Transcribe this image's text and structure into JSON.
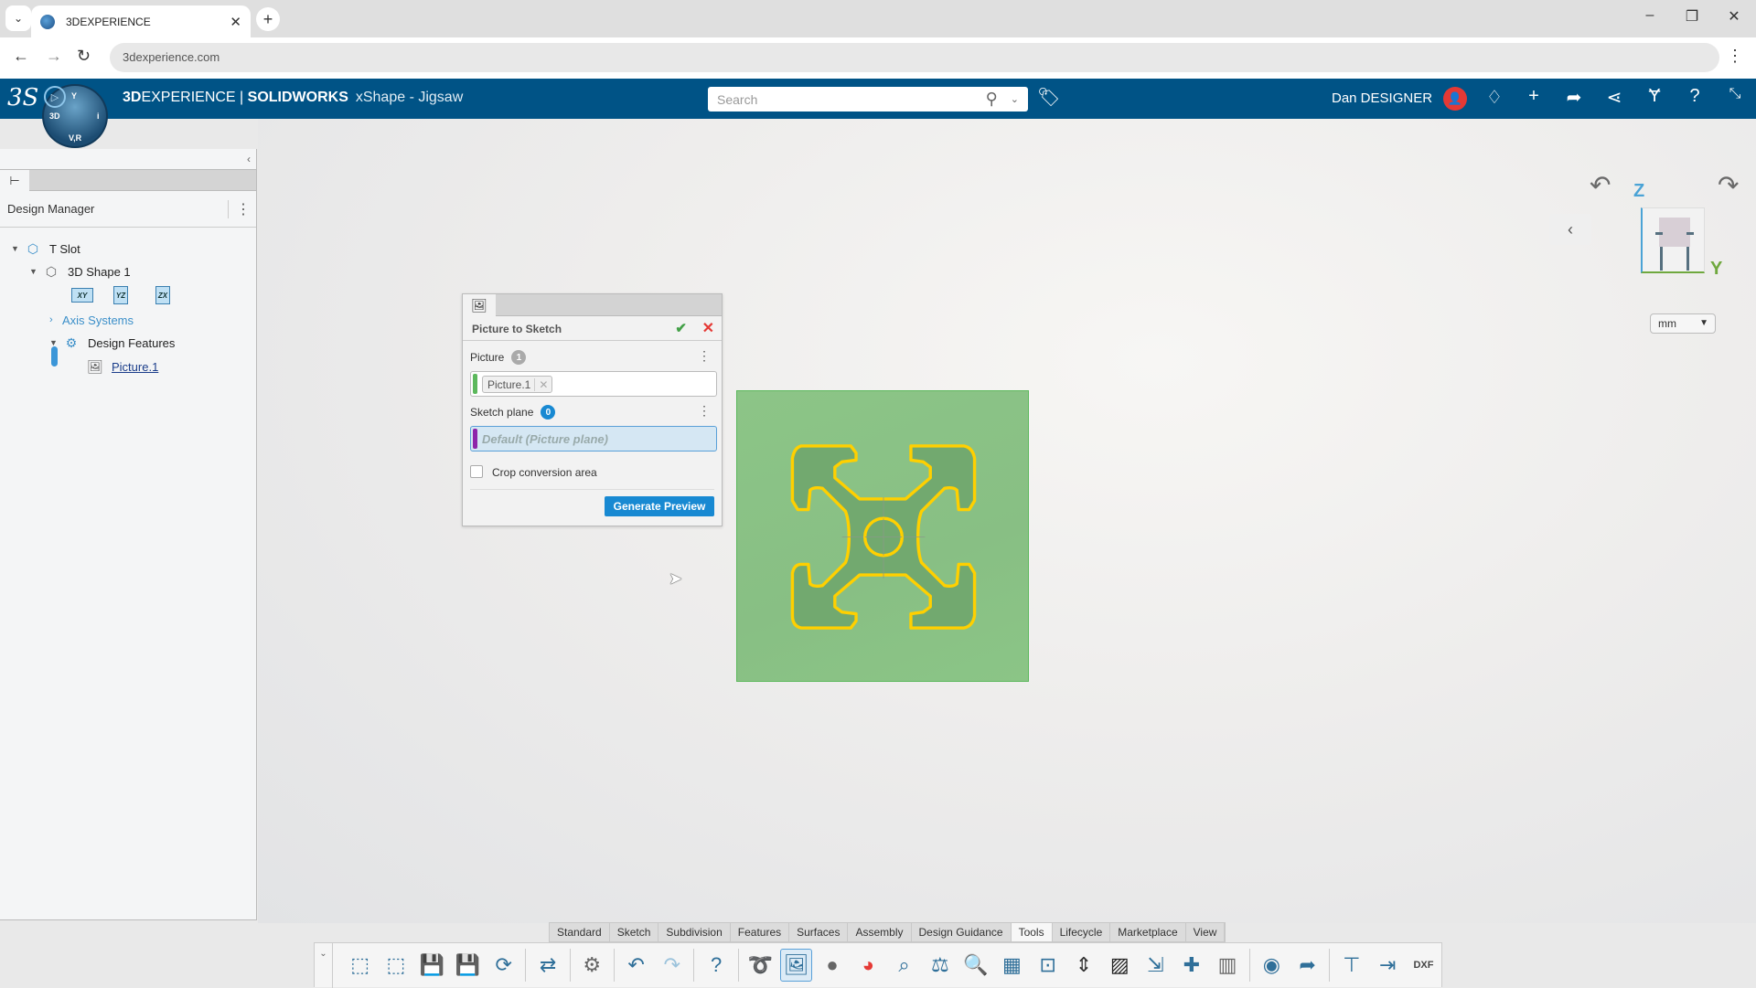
{
  "browser": {
    "tab_title": "3DEXPERIENCE",
    "url": "3dexperience.com",
    "window_controls": [
      "minimize-icon",
      "restore-icon",
      "close-icon"
    ]
  },
  "header": {
    "brand_bold": "3D",
    "brand_rest": "EXPERIENCE | ",
    "brand_product": "SOLIDWORKS",
    "app_name": "xShape - Jigsaw",
    "search_placeholder": "Search",
    "user_name": "Dan DESIGNER",
    "icons": [
      "notifications-icon",
      "add-icon",
      "share-icon",
      "social-icon",
      "apps-compass-icon",
      "help-icon",
      "fullscreen-icon"
    ],
    "compass": {
      "top": "Y",
      "left": "3D",
      "right": "i",
      "bottom": "V,R"
    }
  },
  "sidebar": {
    "title": "Design Manager",
    "tree": [
      {
        "label": "T Slot",
        "level": 0,
        "expanded": true
      },
      {
        "label": "3D Shape 1",
        "level": 1,
        "expanded": true
      },
      {
        "planes": [
          "XY",
          "YZ",
          "ZX"
        ]
      },
      {
        "label": "Axis Systems",
        "level": 2,
        "expanded": false
      },
      {
        "label": "Design Features",
        "level": 2,
        "expanded": true
      },
      {
        "label": "Picture.1",
        "level": 3,
        "selected": true
      }
    ]
  },
  "dialog": {
    "title": "Picture to Sketch",
    "picture_label": "Picture",
    "picture_count": "1",
    "picture_value": "Picture.1",
    "sketch_plane_label": "Sketch plane",
    "sketch_plane_count": "0",
    "sketch_plane_placeholder": "Default (Picture plane)",
    "crop_label": "Crop conversion area",
    "crop_checked": false,
    "generate_button": "Generate Preview"
  },
  "viewport": {
    "axis_z": "Z",
    "axis_y": "Y",
    "unit": "mm"
  },
  "toolbar": {
    "tabs": [
      "Standard",
      "Sketch",
      "Subdivision",
      "Features",
      "Surfaces",
      "Assembly",
      "Design Guidance",
      "Tools",
      "Lifecycle",
      "Marketplace",
      "View"
    ],
    "active_tab": "Tools",
    "icons": [
      "new-icon",
      "open-icon",
      "save-icon",
      "save-as-icon",
      "refresh-icon",
      "replace-icon",
      "options-gear-icon",
      "undo-icon",
      "redo-icon",
      "help-icon",
      "lasso-icon",
      "picture-to-sketch-icon",
      "render-icon",
      "color-wheel-icon",
      "measure-icon",
      "mass-properties-icon",
      "inspect-icon",
      "bom-icon",
      "zoom-fit-icon",
      "section-icon",
      "zebra-icon",
      "import-icon",
      "insert-icon",
      "library-icon",
      "image-capture-icon",
      "share-arrow-icon",
      "3d-print-icon",
      "cam-icon",
      "dxf-export-icon"
    ]
  }
}
